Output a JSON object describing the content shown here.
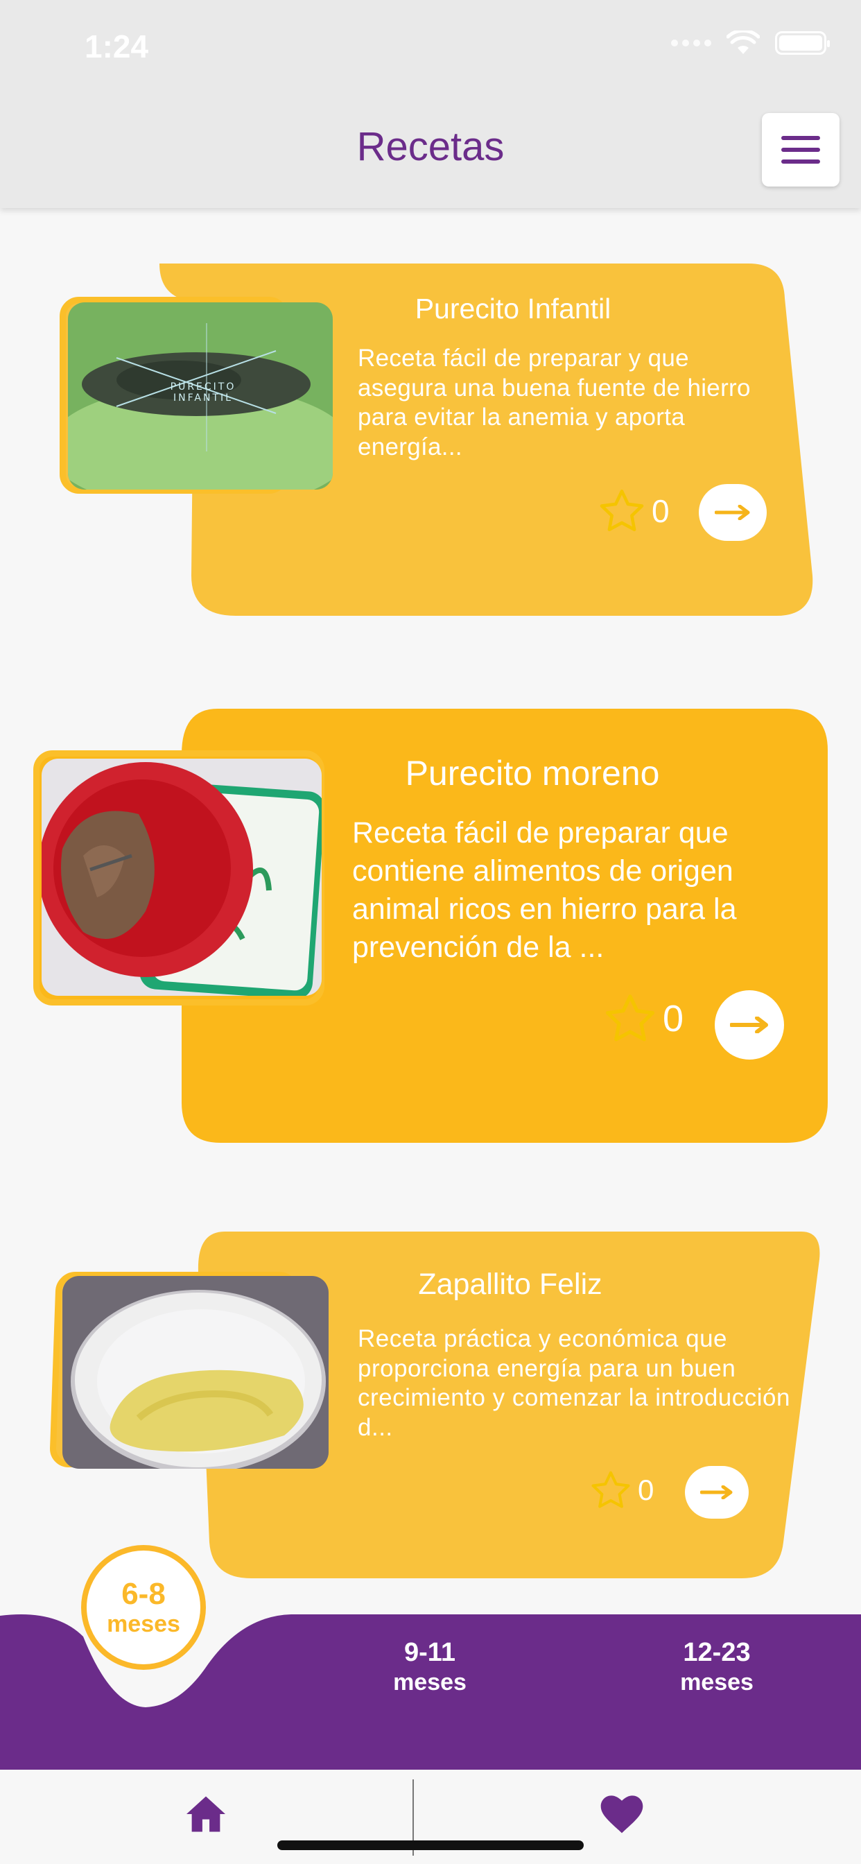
{
  "status_bar": {
    "time": "1:24"
  },
  "header": {
    "title": "Recetas"
  },
  "recipes": [
    {
      "title": "Purecito Infantil",
      "description": "Receta fácil de preparar y que asegura una buena fuente de hierro para evitar la anemia  y aporta energía...",
      "rating": "0",
      "photo_overlay": [
        "PURECITO",
        "INFANTIL"
      ]
    },
    {
      "title": "Purecito moreno",
      "description": "Receta fácil de preparar que contiene alimentos de origen animal ricos en hierro para la prevención de la ...",
      "rating": "0"
    },
    {
      "title": "Zapallito Feliz",
      "description": "Receta práctica y económica que proporciona energía para un buen crecimiento y comenzar la introducción d...",
      "rating": "0"
    }
  ],
  "age_tabs": [
    {
      "top": "6-8",
      "bottom": "meses",
      "selected": true
    },
    {
      "top": "9-11",
      "bottom": "meses",
      "selected": false
    },
    {
      "top": "12-23",
      "bottom": "meses",
      "selected": false
    }
  ],
  "colors": {
    "purple": "#6b2c8a",
    "card_light": "#f9c23c",
    "card_strong": "#fbb81a",
    "header_bg": "#e9e9e9"
  },
  "icons": {
    "menu": "hamburger-icon",
    "star": "star-outline-icon",
    "arrow": "arrow-right-icon",
    "home": "home-icon",
    "favorites": "heart-icon"
  }
}
